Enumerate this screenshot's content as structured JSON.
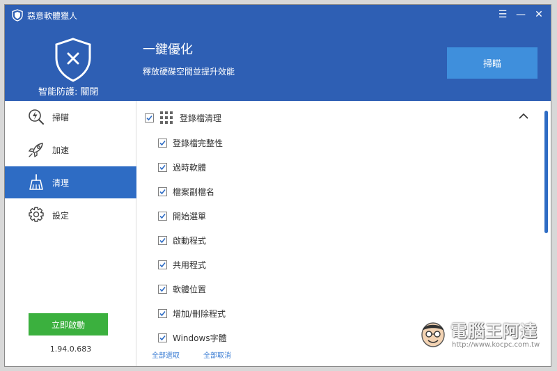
{
  "app": {
    "title": "惡意軟體獵人",
    "version": "1.94.0.683"
  },
  "header": {
    "protection_status": "智能防護: 關閉",
    "title": "一鍵優化",
    "subtitle": "釋放硬碟空間並提升效能",
    "scan_button": "掃瞄"
  },
  "window_controls": {
    "menu": "☰",
    "minimize": "—",
    "close": "✕"
  },
  "sidebar": {
    "items": [
      {
        "label": "掃瞄",
        "icon": "scan-icon"
      },
      {
        "label": "加速",
        "icon": "rocket-icon"
      },
      {
        "label": "清理",
        "icon": "broom-icon",
        "active": true
      },
      {
        "label": "設定",
        "icon": "gear-icon"
      }
    ],
    "start_button": "立即啟動"
  },
  "content": {
    "group": {
      "label": "登錄檔清理",
      "checked": true,
      "icon": "grid-icon"
    },
    "items": [
      {
        "label": "登錄檔完整性",
        "checked": true
      },
      {
        "label": "過時軟體",
        "checked": true
      },
      {
        "label": "檔案副檔名",
        "checked": true
      },
      {
        "label": "開始選單",
        "checked": true
      },
      {
        "label": "啟動程式",
        "checked": true
      },
      {
        "label": "共用程式",
        "checked": true
      },
      {
        "label": "軟體位置",
        "checked": true
      },
      {
        "label": "增加/刪除程式",
        "checked": true
      },
      {
        "label": "Windows字體",
        "checked": true
      }
    ],
    "select_all": "全部選取",
    "deselect_all": "全部取消"
  },
  "watermark": {
    "text": "電腦王阿達",
    "url": "http://www.kocpc.com.tw"
  },
  "colors": {
    "header_bg": "#2e5fb4",
    "accent_button": "#3f8fdc",
    "active_nav": "#2e6cc4",
    "start_button": "#3bb03e",
    "link": "#3e7fd4"
  }
}
